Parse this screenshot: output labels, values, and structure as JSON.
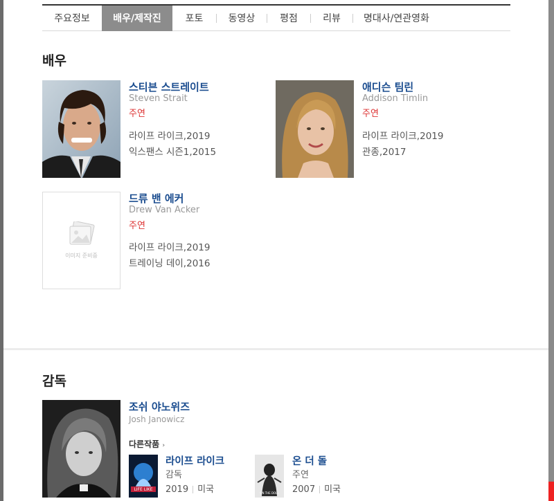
{
  "tabs": [
    {
      "label": "주요정보",
      "active": false
    },
    {
      "label": "배우/제작진",
      "active": true
    },
    {
      "label": "포토",
      "active": false
    },
    {
      "label": "동영상",
      "active": false
    },
    {
      "label": "평점",
      "active": false
    },
    {
      "label": "리뷰",
      "active": false
    },
    {
      "label": "명대사/연관영화",
      "active": false
    }
  ],
  "actors_section": {
    "title": "배우",
    "actors": [
      {
        "name_ko": "스티븐 스트레이트",
        "name_en": "Steven Strait",
        "role": "주연",
        "works": [
          "라이프 라이크,2019",
          "익스팬스 시즌1,2015"
        ]
      },
      {
        "name_ko": "애디슨 팀린",
        "name_en": "Addison Timlin",
        "role": "주연",
        "works": [
          "라이프 라이크,2019",
          "관종,2017"
        ]
      },
      {
        "name_ko": "드류 밴 에커",
        "name_en": "Drew Van Acker",
        "role": "주연",
        "works": [
          "라이프 라이크,2019",
          "트레이닝 데이,2016"
        ],
        "placeholder_text": "이미지 준비중"
      }
    ]
  },
  "director_section": {
    "title": "감독",
    "name_ko": "조쉬 야노위즈",
    "name_en": "Josh Janowicz",
    "other_works_label": "다른작품",
    "films": [
      {
        "title": "라이프 라이크",
        "role": "감독",
        "year": "2019",
        "country": "미국",
        "poster_text": "LIFE LIKE"
      },
      {
        "title": "온 더 돌",
        "role": "주연",
        "year": "2007",
        "country": "미국",
        "poster_text": "ON THE DOLL"
      }
    ]
  },
  "colors": {
    "accent_link": "#1a4c8f",
    "role_red": "#d33",
    "active_tab": "#8c8c8c"
  }
}
